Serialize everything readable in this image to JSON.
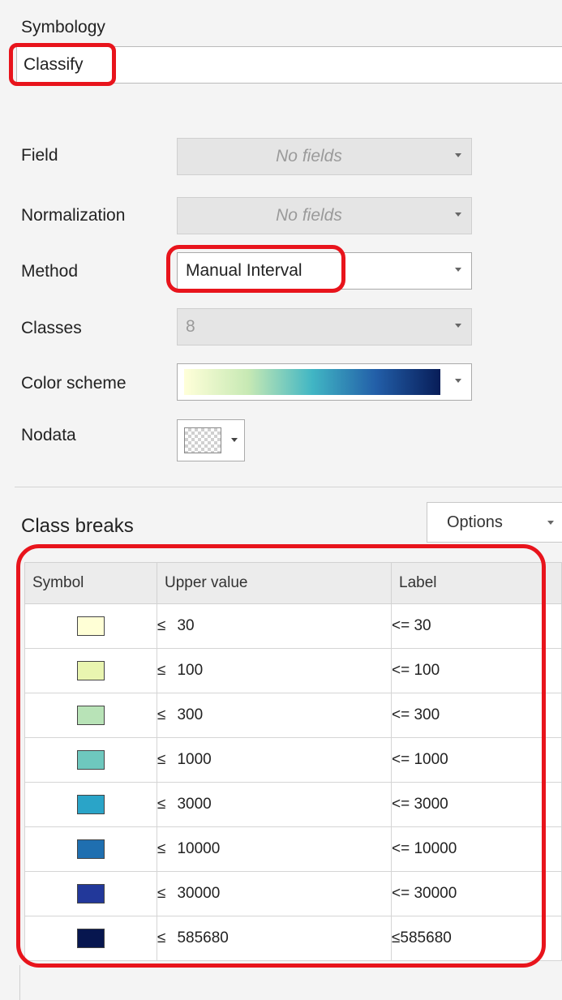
{
  "symbology": {
    "heading": "Symbology",
    "renderer_value": "Classify"
  },
  "fields": {
    "field": {
      "label": "Field",
      "placeholder": "No fields"
    },
    "normalization": {
      "label": "Normalization",
      "placeholder": "No fields"
    },
    "method": {
      "label": "Method",
      "value": "Manual Interval"
    },
    "classes": {
      "label": "Classes",
      "value": "8"
    },
    "color_scheme": {
      "label": "Color scheme",
      "gradient": [
        "#ffffd9",
        "#c7e9b4",
        "#41b6c4",
        "#225ea8",
        "#081d58"
      ]
    },
    "nodata": {
      "label": "Nodata"
    }
  },
  "class_breaks": {
    "heading": "Class breaks",
    "options_label": "Options",
    "columns": [
      "Symbol",
      "Upper value",
      "Label"
    ],
    "rows": [
      {
        "color": "#ffffd6",
        "le": "≤",
        "upper": "30",
        "label": "<= 30"
      },
      {
        "color": "#e9f5b0",
        "le": "≤",
        "upper": "100",
        "label": "<= 100"
      },
      {
        "color": "#b8e3b7",
        "le": "≤",
        "upper": "300",
        "label": "<= 300"
      },
      {
        "color": "#6ec8be",
        "le": "≤",
        "upper": "1000",
        "label": "<= 1000"
      },
      {
        "color": "#2aa4c8",
        "le": "≤",
        "upper": "3000",
        "label": "<= 3000"
      },
      {
        "color": "#1f6fb0",
        "le": "≤",
        "upper": "10000",
        "label": "<= 10000"
      },
      {
        "color": "#22389a",
        "le": "≤",
        "upper": "30000",
        "label": "<= 30000"
      },
      {
        "color": "#07164f",
        "le": "≤",
        "upper": "585680",
        "label": "≤585680"
      }
    ]
  }
}
